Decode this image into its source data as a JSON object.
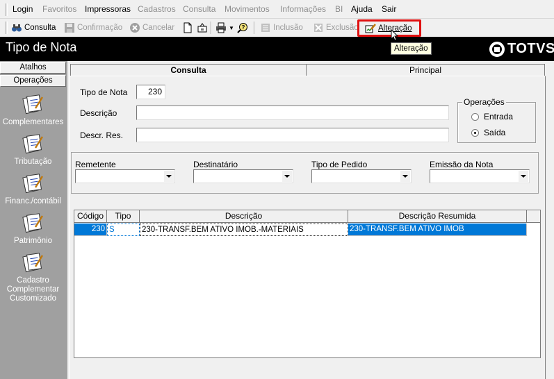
{
  "menu": {
    "login": "Login",
    "favoritos": "Favoritos",
    "impressoras": "Impressoras",
    "cadastros": "Cadastros",
    "consulta": "Consulta",
    "movimentos": "Movimentos",
    "informacoes": "Informações",
    "bi": "BI",
    "ajuda": "Ajuda",
    "sair": "Sair"
  },
  "toolbar": {
    "consulta": "Consulta",
    "confirmacao": "Confirmação",
    "cancelar": "Cancelar",
    "inclusao": "Inclusão",
    "exclusao": "Exclusão",
    "alteracao": "Alteração"
  },
  "title": "Tipo de Nota",
  "logo": "TOTVS",
  "tooltip": "Alteração",
  "sidebar": {
    "atalhos": "Atalhos",
    "operacoes": "Operações",
    "items": [
      {
        "label": "Complementares"
      },
      {
        "label": "Tributação"
      },
      {
        "label": "Financ./contábil"
      },
      {
        "label": "Patrimônio"
      },
      {
        "label": "Cadastro Complementar Customizado"
      }
    ]
  },
  "tabs": {
    "consulta": "Consulta",
    "principal": "Principal"
  },
  "form": {
    "tipo_nota_label": "Tipo de Nota",
    "tipo_nota_value": "230",
    "descricao_label": "Descrição",
    "descricao_value": "",
    "descr_res_label": "Descr. Res.",
    "descr_res_value": "",
    "operacoes_title": "Operações",
    "entrada": "Entrada",
    "saida": "Saída",
    "operacao_selected": "Saída"
  },
  "filters": {
    "remetente": "Remetente",
    "destinatario": "Destinatário",
    "tipo_pedido": "Tipo de Pedido",
    "emissao_nota": "Emissão da Nota"
  },
  "grid": {
    "headers": [
      "Código",
      "Tipo",
      "Descrição",
      "Descrição Resumida"
    ],
    "rows": [
      [
        "230",
        "S",
        "230-TRANSF.BEM ATIVO IMOB.-MATERIAIS",
        "230-TRANSF.BEM ATIVO IMOB"
      ]
    ]
  }
}
